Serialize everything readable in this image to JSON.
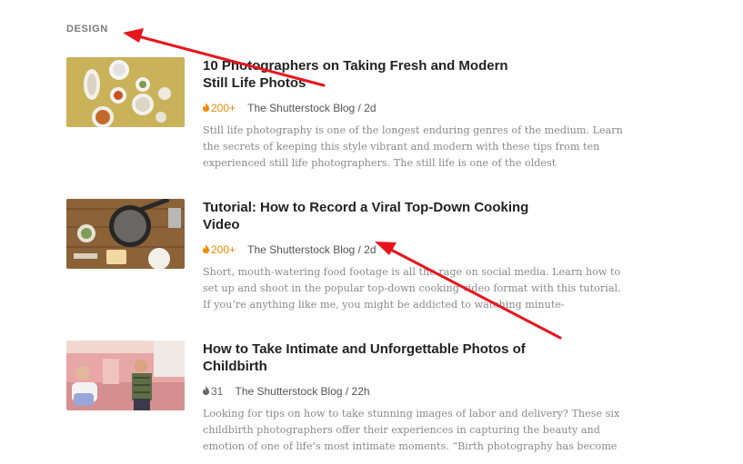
{
  "section": {
    "label": "DESIGN"
  },
  "articles": [
    {
      "title": "10 Photographers on Taking Fresh and Modern Still Life Photos",
      "heat": "200+",
      "heat_hot": true,
      "source": "The Shutterstock Blog / 2d",
      "excerpt": "Still life photography is one of the longest enduring genres of the medium. Learn the secrets of keeping this style vibrant and modern with these tips from ten experienced still life photographers. The still life is one of the oldest",
      "thumbnail": "still-life-bowls-thumbnail"
    },
    {
      "title": "Tutorial: How to Record a Viral Top-Down Cooking Video",
      "heat": "200+",
      "heat_hot": true,
      "source": "The Shutterstock Blog / 2d",
      "excerpt": "Short, mouth-watering food footage is all the rage on social media. Learn how to set up and shoot in the popular top-down cooking video format with this tutorial. If you’re anything like me, you might be addicted to watching minute-",
      "thumbnail": "cooking-pan-thumbnail"
    },
    {
      "title": "How to Take Intimate and Unforgettable Photos of Childbirth",
      "heat": "31",
      "heat_hot": false,
      "source": "The Shutterstock Blog / 22h",
      "excerpt": "Looking for tips on how to take stunning images of labor and delivery? These six childbirth photographers offer their experiences in capturing the beauty and emotion of one of life’s most intimate moments. “Birth photography has become",
      "thumbnail": "childbirth-room-thumbnail"
    }
  ],
  "colors": {
    "hot": "#f08a00",
    "annotation_arrow": "#e8141c",
    "title": "#222222",
    "excerpt": "#8a8a8a"
  }
}
